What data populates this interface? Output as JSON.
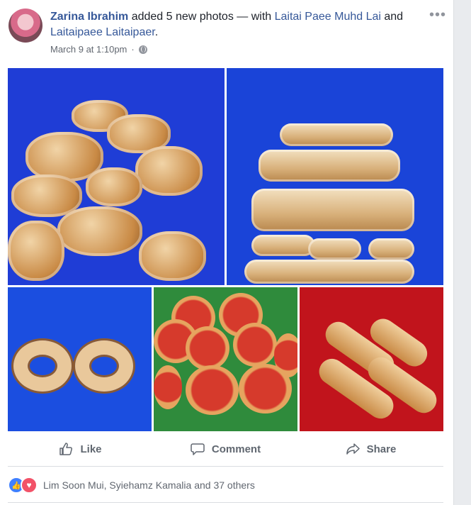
{
  "post": {
    "author": "Zarina Ibrahim",
    "action_text": " added 5 new photos — with ",
    "tagged_1": "Laitai Paee Muhd Lai",
    "and_text": " and ",
    "tagged_2": "Laitaipaee Laitaipaer",
    "end_text": ".",
    "timestamp": "March 9 at 1:10pm",
    "separator": "·",
    "privacy_icon": "globe-icon",
    "more_label": "•••"
  },
  "photos": [
    {
      "description": "photo-1",
      "color": "#1f3dd6"
    },
    {
      "description": "photo-2",
      "color": "#1a44d8"
    },
    {
      "description": "photo-3",
      "color": "#1b4ee0"
    },
    {
      "description": "photo-4",
      "color": "#2f8b3c"
    },
    {
      "description": "photo-5",
      "color": "#c1141c"
    }
  ],
  "actions": {
    "like": "Like",
    "comment": "Comment",
    "share": "Share"
  },
  "reactions": {
    "names": "Lim Soon Mui, Syiehamz Kamalia and 37 others"
  }
}
